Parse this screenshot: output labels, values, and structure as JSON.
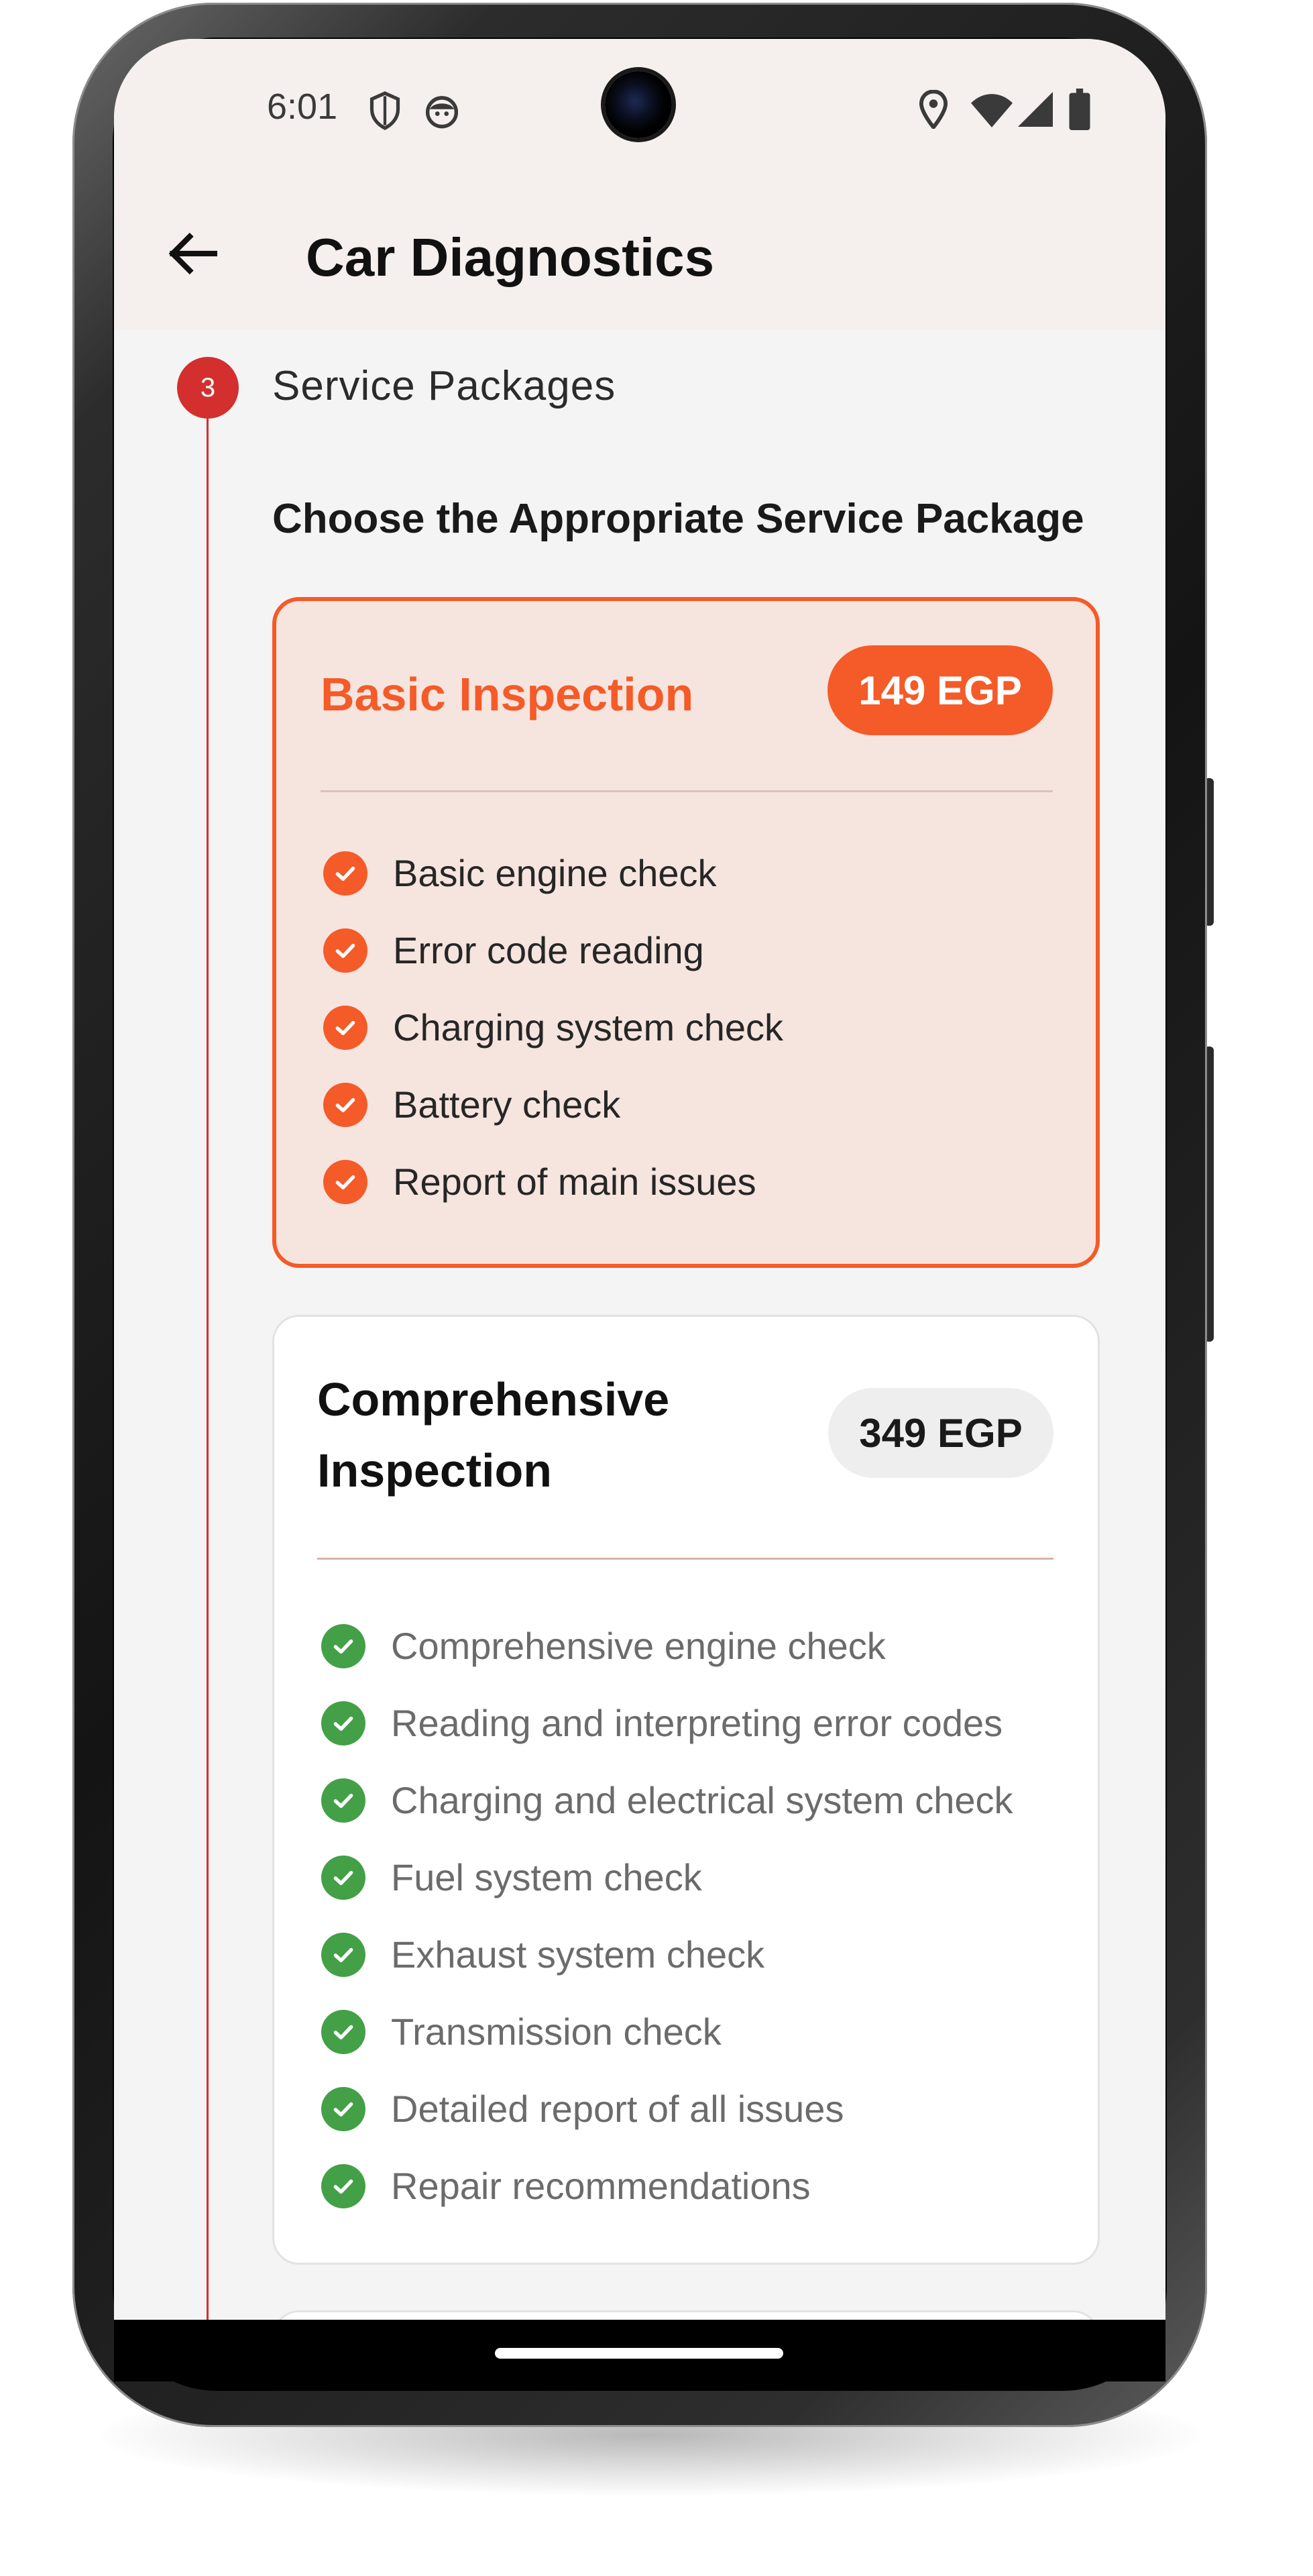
{
  "status_bar": {
    "time": "6:01",
    "left_icons": [
      "shield-icon",
      "face-icon"
    ],
    "right_icons": [
      "location-icon",
      "wifi-icon",
      "signal-icon",
      "battery-icon"
    ]
  },
  "app_bar": {
    "back_icon": "arrow-left-icon",
    "title": "Car Diagnostics"
  },
  "stepper": {
    "step_number": "3",
    "step_label": "Service Packages",
    "accent": "#d32f2f"
  },
  "section": {
    "heading": "Choose the Appropriate Service Package"
  },
  "packages": [
    {
      "name": "Basic Inspection",
      "price": "149 EGP",
      "selected": true,
      "accent": "#f45b28",
      "features": [
        "Basic engine check",
        "Error code reading",
        "Charging system check",
        "Battery check",
        "Report of main issues"
      ]
    },
    {
      "name": "Comprehensive Inspection",
      "price": "349 EGP",
      "selected": false,
      "accent": "#43a047",
      "features": [
        "Comprehensive engine check",
        "Reading and interpreting error codes",
        "Charging and electrical system check",
        "Fuel system check",
        "Exhaust system check",
        "Transmission check",
        "Detailed report of all issues",
        "Repair recommendations"
      ]
    }
  ]
}
